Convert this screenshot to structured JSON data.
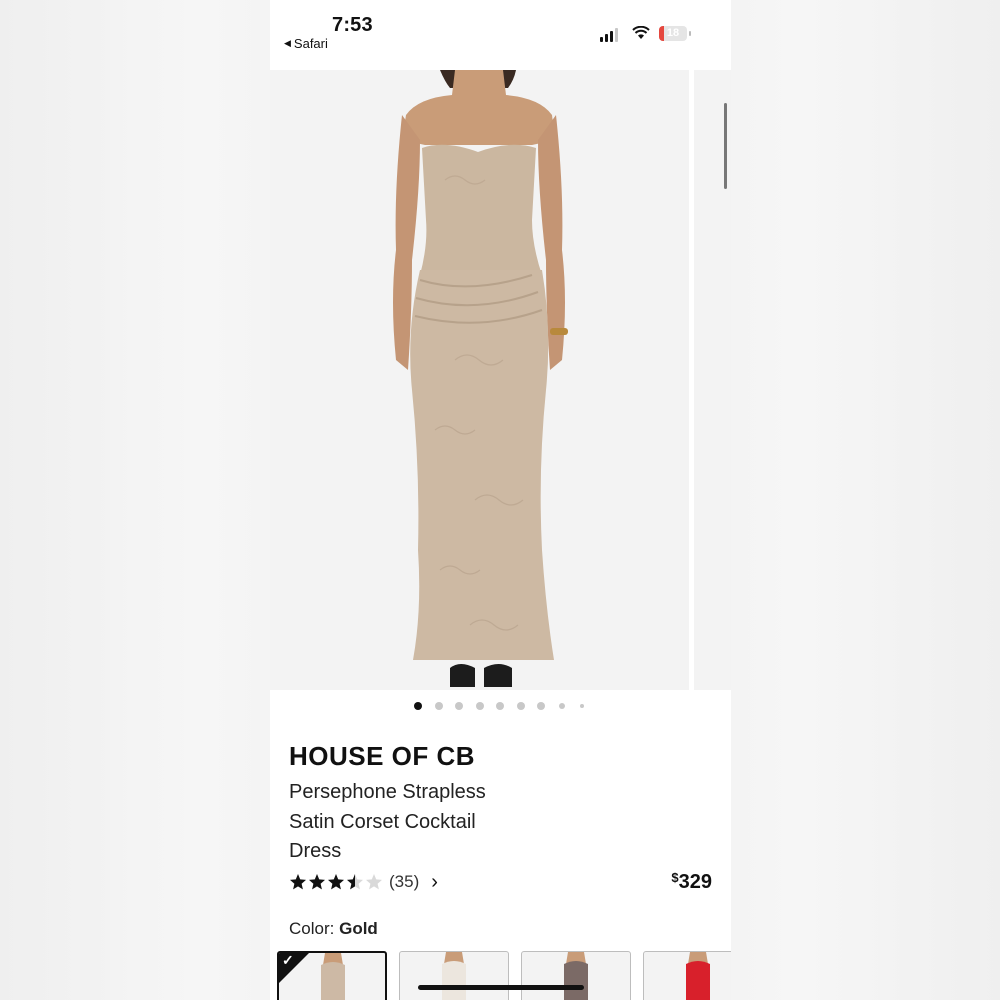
{
  "status_bar": {
    "time": "7:53",
    "back_app": "Safari",
    "battery_level": "18",
    "battery_fraction": 0.18
  },
  "gallery": {
    "image_count": 9,
    "active_index": 0,
    "image_description": "model-wearing-strapless-beige-dress"
  },
  "product": {
    "brand": "HOUSE OF CB",
    "name": "Persephone Strapless Satin Corset Cocktail Dress",
    "rating": 3.5,
    "review_count": "(35)",
    "price_symbol": "$",
    "price_value": "329"
  },
  "color": {
    "label": "Color:",
    "selected": "Gold",
    "swatches": [
      {
        "name": "Gold",
        "color": "#cdb9a5",
        "selected": true
      },
      {
        "name": "Ivory",
        "color": "#ece6de",
        "selected": false
      },
      {
        "name": "Taupe",
        "color": "#7b6a66",
        "selected": false
      },
      {
        "name": "Red",
        "color": "#d8202b",
        "selected": false
      }
    ]
  },
  "colors": {
    "accent": "#111111",
    "battery_low": "#e5473e"
  },
  "icons": [
    "back-arrow-icon",
    "cellular-signal-icon",
    "wifi-icon",
    "battery-icon",
    "star-icon",
    "chevron-right-icon",
    "checkmark-icon"
  ]
}
